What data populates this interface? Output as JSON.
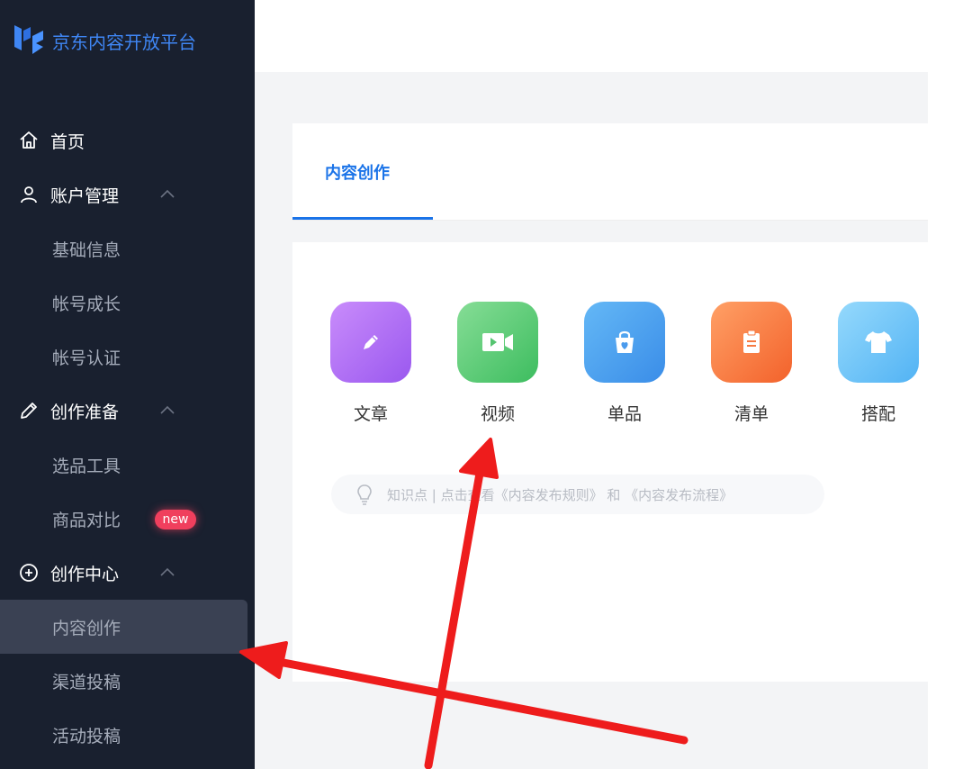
{
  "app": {
    "logo_text": "京东内容开放平台"
  },
  "sidebar": {
    "items": [
      {
        "label": "首页",
        "icon": "home-icon"
      },
      {
        "label": "账户管理",
        "icon": "user-icon"
      },
      {
        "label": "基础信息"
      },
      {
        "label": "帐号成长"
      },
      {
        "label": "帐号认证"
      },
      {
        "label": "创作准备",
        "icon": "pencil-icon"
      },
      {
        "label": "选品工具"
      },
      {
        "label": "商品对比",
        "badge": "new"
      },
      {
        "label": "创作中心",
        "icon": "plus-circle-icon"
      },
      {
        "label": "内容创作",
        "active": true
      },
      {
        "label": "渠道投稿"
      },
      {
        "label": "活动投稿"
      }
    ]
  },
  "main": {
    "tab_label": "内容创作",
    "content_types": [
      {
        "label": "文章",
        "icon": "pen-icon",
        "color_from": "#c286f9",
        "color_to": "#9d5cf0"
      },
      {
        "label": "视频",
        "icon": "video-camera-icon",
        "color_from": "#7ed98f",
        "color_to": "#3fbf62"
      },
      {
        "label": "单品",
        "icon": "shopping-bag-icon",
        "color_from": "#5eb4f5",
        "color_to": "#3d8fe9"
      },
      {
        "label": "清单",
        "icon": "clipboard-icon",
        "color_from": "#ff9a5e",
        "color_to": "#f5672f"
      },
      {
        "label": "搭配",
        "icon": "tshirt-icon",
        "color_from": "#8fd6fb",
        "color_to": "#55b6f5"
      }
    ],
    "tip": {
      "icon": "lightbulb-icon",
      "text": "知识点 | 点击查看《内容发布规则》 和 《内容发布流程》"
    }
  },
  "annotation": {
    "arrow_color": "#ee1c1c"
  }
}
